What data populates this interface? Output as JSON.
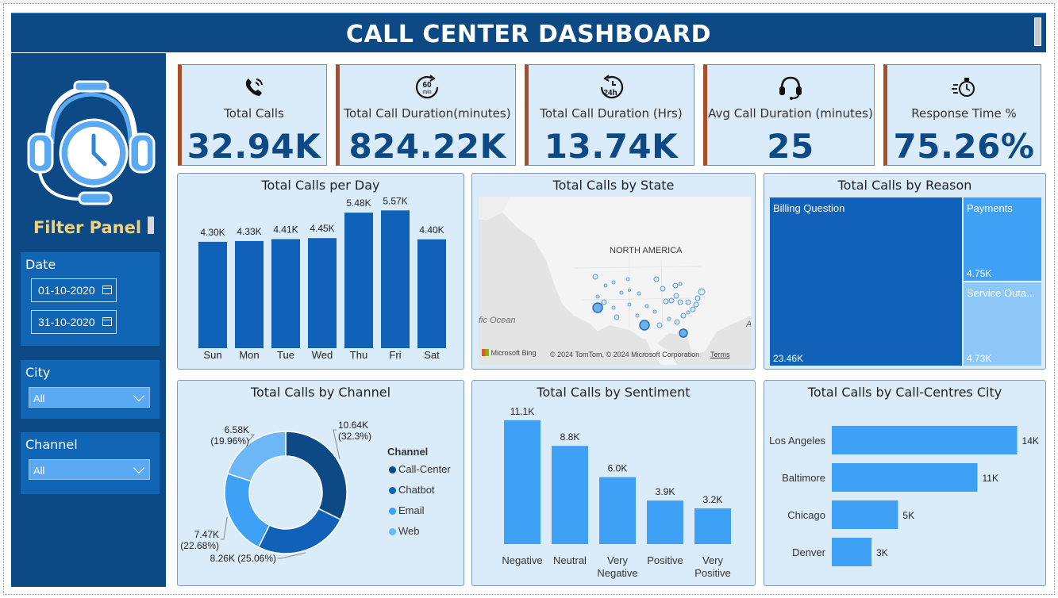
{
  "header": {
    "title": "CALL CENTER DASHBOARD"
  },
  "sidebar": {
    "filter_title": "Filter Panel",
    "date": {
      "label": "Date",
      "from": "01-10-2020",
      "to": "31-10-2020"
    },
    "city": {
      "label": "City",
      "value": "All"
    },
    "channel": {
      "label": "Channel",
      "value": "All"
    }
  },
  "kpis": [
    {
      "label": "Total Calls",
      "value": "32.94K",
      "icon": "phone-icon"
    },
    {
      "label": "Total Call Duration(minutes)",
      "value": "824.22K",
      "icon": "sixty-min-icon",
      "icon_text": "60",
      "icon_sub": "min"
    },
    {
      "label": "Total Call Duration (Hrs)",
      "value": "13.74K",
      "icon": "twentyfour-hours-icon",
      "icon_text": "24h"
    },
    {
      "label": "Avg Call Duration (minutes)",
      "value": "25",
      "icon": "headset-icon"
    },
    {
      "label": "Response Time %",
      "value": "75.26%",
      "icon": "stopwatch-icon"
    }
  ],
  "colors": {
    "dark_blue": "#0d4a85",
    "mid_blue": "#0f62b8",
    "bright_blue": "#3fa1f5",
    "light_blue": "#6cb7f5",
    "panel_bg": "#daebfa",
    "kpi_accent": "#a84f2a"
  },
  "chart_data": [
    {
      "type": "bar",
      "title": "Total Calls per Day",
      "categories": [
        "Sun",
        "Mon",
        "Tue",
        "Wed",
        "Thu",
        "Fri",
        "Sat"
      ],
      "values": [
        4.3,
        4.33,
        4.41,
        4.45,
        5.48,
        5.57,
        4.4
      ],
      "labels": [
        "4.30K",
        "4.33K",
        "4.41K",
        "4.45K",
        "5.48K",
        "5.57K",
        "4.40K"
      ],
      "ylim": [
        0,
        5.9
      ],
      "color": "#0f62b8"
    },
    {
      "type": "map",
      "title": "Total Calls by State",
      "region_label": "NORTH AMERICA",
      "ocean_label": "fic Ocean",
      "attribution": "© 2024 TomTom, © 2024 Microsoft Corporation",
      "terms": "Terms",
      "bing": "Microsoft Bing",
      "edge_letter": "A"
    },
    {
      "type": "treemap",
      "title": "Total Calls by Reason",
      "items": [
        {
          "name": "Billing Question",
          "value": 23.46,
          "label": "23.46K",
          "color": "#0f62b8"
        },
        {
          "name": "Payments",
          "value": 4.75,
          "label": "4.75K",
          "color": "#3fa1f5"
        },
        {
          "name": "Service Outa...",
          "value": 4.73,
          "label": "4.73K",
          "color": "#8ec8f8"
        }
      ]
    },
    {
      "type": "pie",
      "title": "Total Calls by Channel",
      "legend_title": "Channel",
      "slices": [
        {
          "name": "Call-Center",
          "value": 10.64,
          "label": "10.64K",
          "pct": "(32.3%)",
          "color": "#0d4a85"
        },
        {
          "name": "Chatbot",
          "value": 8.26,
          "label": "8.26K (25.06%)",
          "pct": "",
          "color": "#0f62b8"
        },
        {
          "name": "Email",
          "value": 7.47,
          "label": "7.47K",
          "pct": "(22.68%)",
          "color": "#3fa1f5"
        },
        {
          "name": "Web",
          "value": 6.58,
          "label": "6.58K",
          "pct": "(19.96%)",
          "color": "#6cb7f5"
        }
      ]
    },
    {
      "type": "bar",
      "title": "Total Calls by Sentiment",
      "categories": [
        [
          "Negative"
        ],
        [
          "Neutral"
        ],
        [
          "Very",
          "Negative"
        ],
        [
          "Positive"
        ],
        [
          "Very",
          "Positive"
        ]
      ],
      "values": [
        11.1,
        8.8,
        6.0,
        3.9,
        3.2
      ],
      "labels": [
        "11.1K",
        "8.8K",
        "6.0K",
        "3.9K",
        "3.2K"
      ],
      "ylim": [
        0,
        11.8
      ],
      "color": "#3fa1f5"
    },
    {
      "type": "bar",
      "orientation": "horizontal",
      "title": "Total Calls by Call-Centres City",
      "categories": [
        "Los Angeles",
        "Baltimore",
        "Chicago",
        "Denver"
      ],
      "values": [
        14,
        11,
        5,
        3
      ],
      "labels": [
        "14K",
        "11K",
        "5K",
        "3K"
      ],
      "xlim": [
        0,
        14.5
      ],
      "color": "#3fa1f5"
    }
  ]
}
